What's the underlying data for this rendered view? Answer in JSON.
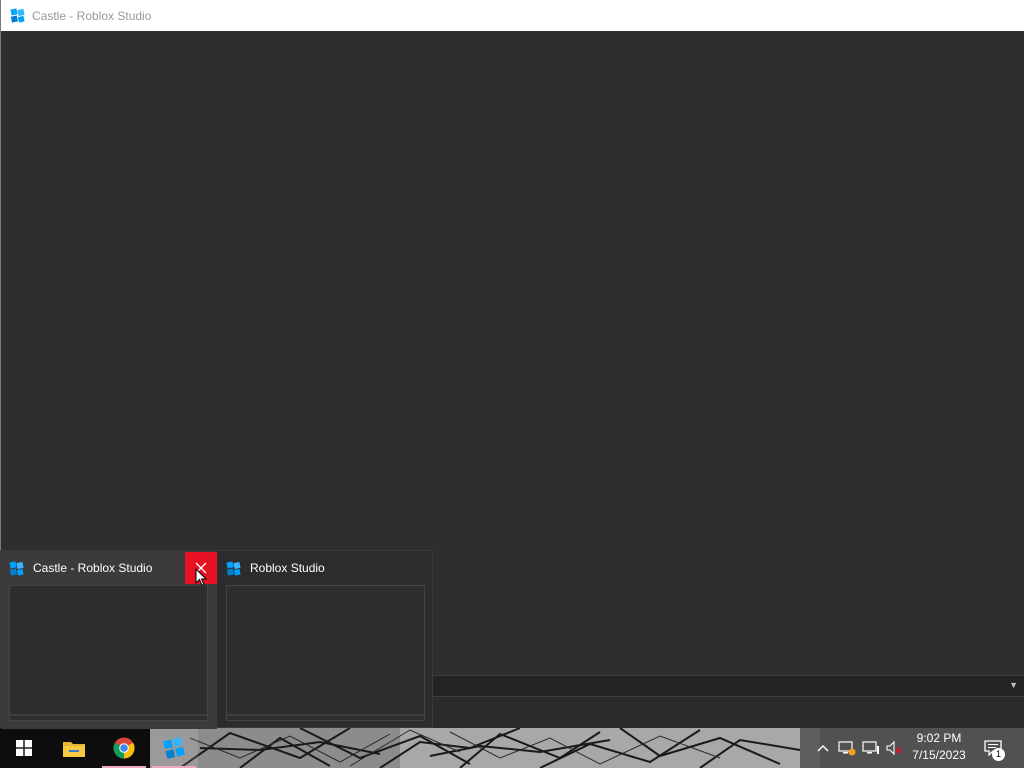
{
  "window": {
    "title": "Castle - Roblox Studio"
  },
  "preview": {
    "thumbnails": [
      {
        "title": "Castle - Roblox Studio",
        "hovered": true
      },
      {
        "title": "Roblox Studio",
        "hovered": false
      }
    ]
  },
  "taskbar": {
    "buttons": [
      {
        "name": "start",
        "icon": "windows-logo-icon"
      },
      {
        "name": "file-explorer",
        "icon": "folder-icon"
      },
      {
        "name": "chrome",
        "icon": "chrome-icon"
      },
      {
        "name": "roblox-studio",
        "icon": "roblox-studio-icon"
      }
    ],
    "clock": {
      "time": "9:02 PM",
      "date": "7/15/2023"
    },
    "notifications": {
      "count": "1"
    }
  },
  "colors": {
    "close_hover": "#e81123",
    "studio_blue": "#00a2ff",
    "active_underline": "#f0a8bd"
  }
}
